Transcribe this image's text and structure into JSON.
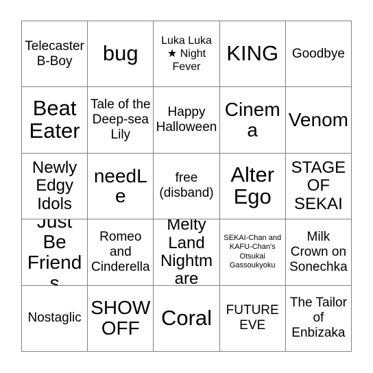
{
  "card": {
    "type": "bingo-card",
    "rows": 5,
    "columns": 5,
    "border_color": "#808080",
    "background_color": "#ffffff",
    "text_color": "#000000",
    "free_space": "free (disband)",
    "cells": [
      {
        "text": "Telecaster B-Boy",
        "size": "md"
      },
      {
        "text": "bug",
        "size": "xxl"
      },
      {
        "text": "Luka Luka ★ Night Fever",
        "size": "sm"
      },
      {
        "text": "KING",
        "size": "xxl"
      },
      {
        "text": "Goodbye",
        "size": "md"
      },
      {
        "text": "Beat Eater",
        "size": "xxl"
      },
      {
        "text": "Tale of the Deep-sea Lily",
        "size": "md"
      },
      {
        "text": "Happy Halloween",
        "size": "md"
      },
      {
        "text": "Cinema",
        "size": "xl"
      },
      {
        "text": "Venom",
        "size": "xl"
      },
      {
        "text": "Newly Edgy Idols",
        "size": "lg"
      },
      {
        "text": "needLe",
        "size": "xl"
      },
      {
        "text": "free (disband)",
        "size": "md"
      },
      {
        "text": "Alter Ego",
        "size": "xxl"
      },
      {
        "text": "STAGE OF SEKAI",
        "size": "lg"
      },
      {
        "text": "Just Be Friends",
        "size": "xl"
      },
      {
        "text": "Romeo and Cinderella",
        "size": "md"
      },
      {
        "text": "Melty Land Nightmare",
        "size": "lg"
      },
      {
        "text": "SEKAI-Chan and KAFU-Chan's Otsukai Gassoukyoku",
        "size": "xxs"
      },
      {
        "text": "Milk Crown on Sonechka",
        "size": "md"
      },
      {
        "text": "Nostaglic",
        "size": "md"
      },
      {
        "text": "SHOW OFF",
        "size": "xl"
      },
      {
        "text": "Coral",
        "size": "xxl"
      },
      {
        "text": "FUTURE EVE",
        "size": "md"
      },
      {
        "text": "The Tailor of Enbizaka",
        "size": "md"
      }
    ]
  }
}
